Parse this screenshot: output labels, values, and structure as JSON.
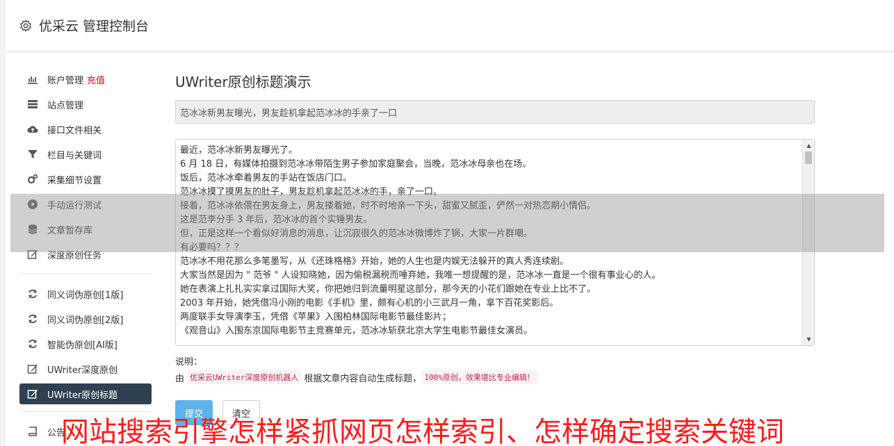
{
  "header": {
    "title": "优采云 管理控制台",
    "icon": "gear-icon"
  },
  "sidebar": {
    "items": [
      {
        "label": "账户管理",
        "extra": "充值",
        "icon": "bar-chart-icon"
      },
      {
        "label": "站点管理",
        "icon": "server-icon"
      },
      {
        "label": "接口文件相关",
        "icon": "cloud-upload-icon"
      },
      {
        "label": "栏目与关键词",
        "icon": "filter-icon"
      },
      {
        "label": "采集细节设置",
        "icon": "cogs-icon"
      },
      {
        "label": "手动运行测试",
        "icon": "play-circle-icon"
      },
      {
        "label": "文章暂存库",
        "icon": "database-icon"
      },
      {
        "label": "深度原创任务",
        "icon": "edit-icon"
      }
    ],
    "items2": [
      {
        "label": "同义词伪原创[1版]",
        "icon": "refresh-icon"
      },
      {
        "label": "同义词伪原创[2版]",
        "icon": "refresh-icon"
      },
      {
        "label": "智能伪原创[AI版]",
        "icon": "refresh-icon"
      },
      {
        "label": "UWriter深度原创",
        "icon": "edit-icon"
      },
      {
        "label": "UWriter原创标题",
        "icon": "edit-icon",
        "active": true
      }
    ],
    "items3": [
      {
        "label": "公告",
        "icon": "book-icon"
      }
    ]
  },
  "main": {
    "heading": "UWriter原创标题演示",
    "title_value": "范冰冰新男友曝光，男友趁机拿起范冰冰的手亲了一口",
    "content_lines": [
      "最近，范冰冰新男友曝光了。",
      "6 月 18 日，有媒体拍摄到范冰冰带陌生男子参加家庭聚会，当晚，范冰冰母亲也在场。",
      "饭后，范冰冰牵着男友的手站在饭店门口。",
      "范冰冰摸了摸男友的肚子，男友趁机拿起范冰冰的手，亲了一口。",
      "接着，范冰冰依偎在男友身上，男友搂着她，时不时地亲一下头，甜蜜又腻歪，俨然一对热恋期小情侣。",
      "这是范李分手 3 年后，范冰冰的首个实锤男友。",
      "但，正是这样一个看似好消息的消息，让沉寂很久的范冰冰微博炸了锅，大家一片群嘲。",
      "有必要吗？？？",
      "范冰冰不用花那么多笔墨写，从《还珠格格》开始，她的人生也是内娱无法躲开的真人秀连续剧。",
      "大家当然是因为 \" 范爷 \" 人设知晓她，因为偷税漏税而唾弃她，我唯一想提醒的是，范冰冰一直是一个很有事业心的人。",
      "她在表演上扎扎实实拿过国际大奖，你把她归到流量明星这部分，那今天的小花们跟她在专业上比不了。",
      "2003 年开始，她凭借冯小刚的电影《手机》里，颇有心机的小三武月一角，拿下百花奖影后。",
      "两度联手女导演李玉，凭借《苹果》入围柏林国际电影节最佳影片；",
      "《观音山》入围东京国际电影节主竞赛单元，范冰冰斩获北京大学生电影节最佳女演员。"
    ],
    "notes_label": "说明：",
    "notes_prefix": "由",
    "notes_tag1": "优采云UWriter深度原创机器人",
    "notes_middle": "根据文章内容自动生成标题，",
    "notes_tag2": "100%原创，效果堪比专业编辑！",
    "submit_label": "提交",
    "clear_label": "清空"
  },
  "banner": "网站搜索引擎怎样紧抓网页怎样索引、怎样确定搜索关键词",
  "colors": {
    "accent": "#2f4050",
    "highlight": "#e60012",
    "primary_button": "#5eb2ec",
    "banner": "#ff1a1a"
  }
}
